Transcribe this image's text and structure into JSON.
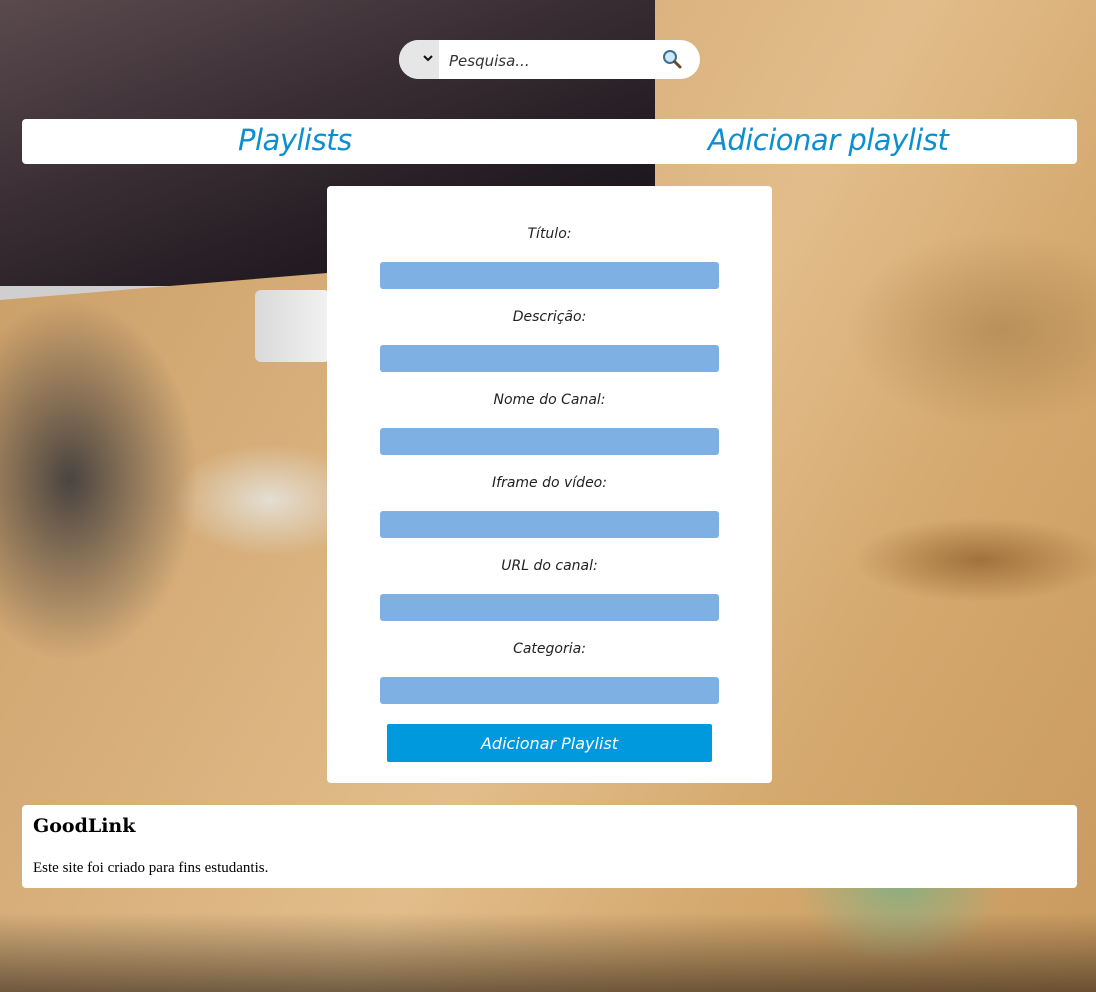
{
  "search": {
    "placeholder": "Pesquisa..."
  },
  "nav": {
    "playlists": "Playlists",
    "add_playlist": "Adicionar playlist"
  },
  "form": {
    "fields": [
      {
        "label": "Título:"
      },
      {
        "label": "Descrição:"
      },
      {
        "label": "Nome do Canal:"
      },
      {
        "label": "Iframe do vídeo:"
      },
      {
        "label": "URL do canal:"
      },
      {
        "label": "Categoria:"
      }
    ],
    "submit_label": "Adicionar Playlist"
  },
  "footer": {
    "title": "GoodLink",
    "text": "Este site foi criado para fins estudantis."
  },
  "colors": {
    "link": "#0c8fd1",
    "input_fill": "#7eb0e3",
    "button": "#0099dd"
  },
  "icons": {
    "search": "magnifier-icon",
    "select": "chevron-down-icon"
  }
}
